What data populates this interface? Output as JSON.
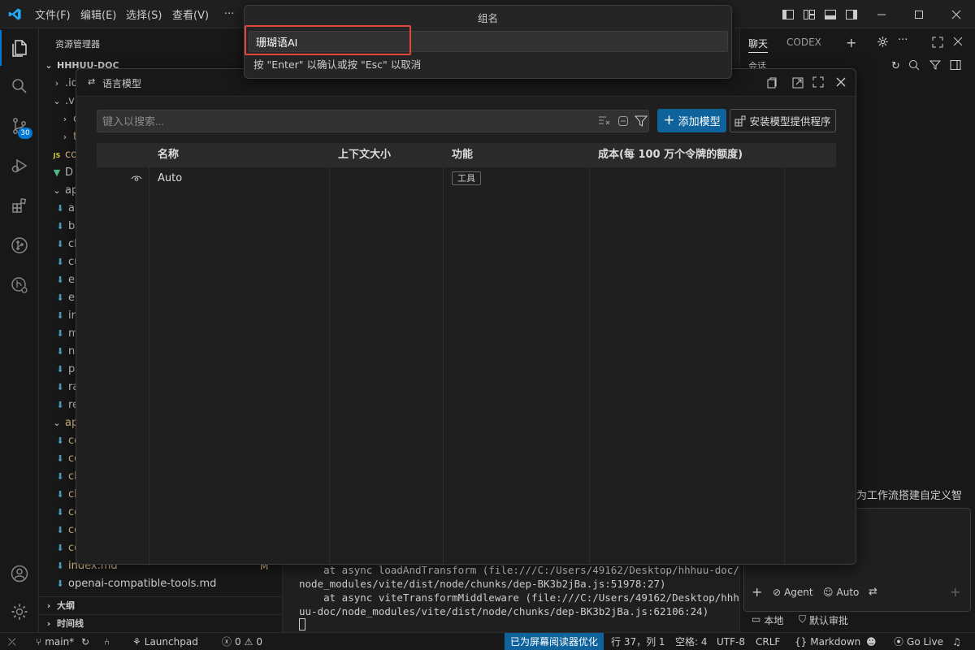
{
  "titlebar": {
    "menu": [
      "文件(F)",
      "编辑(E)",
      "选择(S)",
      "查看(V)",
      "···"
    ],
    "path_fragment": "vite/dist/node/chunks/dep-BK3b2jBa.js:51978"
  },
  "activitybar": {
    "source_control_badge": "30"
  },
  "explorer": {
    "title": "资源管理器",
    "root": "HHHUU-DOC",
    "rows": [
      ".ide",
      ".vit",
      "ca",
      "th",
      "co",
      "D",
      "api",
      "a",
      "b",
      "cl",
      "cu",
      "e",
      "e",
      "ir",
      "m",
      "n",
      "p",
      "ra",
      "re",
      "app",
      "co",
      "co",
      "cl",
      "cl",
      "co",
      "co",
      "co"
    ],
    "index_file": "index.md",
    "index_status": "M",
    "tools_file": "openai-compatible-tools.md",
    "outline": "大纲",
    "timeline": "时间线"
  },
  "terminal": {
    "lines": [
      "    at async loadAndTransform (file:///C:/Users/49162/Desktop/hhhuu-doc/",
      "node_modules/vite/dist/node/chunks/dep-BK3b2jBa.js:51978:27)",
      "    at async viteTransformMiddleware (file:///C:/Users/49162/Desktop/hhh",
      "uu-doc/node_modules/vite/dist/node/chunks/dep-BK3b2jBa.js:62106:24)"
    ]
  },
  "chat": {
    "tabs": [
      "聊天",
      "CODEX"
    ],
    "session_label": "会话",
    "hint": "为工作流搭建自定义智",
    "mode": "Agent",
    "model": "Auto",
    "local": "本地",
    "approval": "默认审批"
  },
  "lm_dialog": {
    "title": "语言模型",
    "search_placeholder": "键入以搜索...",
    "add_model": "添加模型",
    "install_provider": "安装模型提供程序",
    "columns": [
      "名称",
      "上下文大小",
      "功能",
      "成本(每 100 万个令牌的额度)"
    ],
    "rows": [
      {
        "name": "Auto",
        "context": "",
        "capability": "工具",
        "cost": ""
      }
    ]
  },
  "quick_input": {
    "title": "组名",
    "value": "珊瑚语AI",
    "hint": "按 \"Enter\" 以确认或按 \"Esc\" 以取消"
  },
  "statusbar": {
    "branch": "main*",
    "launchpad": "Launchpad",
    "errors": "0",
    "warnings": "0",
    "screen_reader": "已为屏幕阅读器优化",
    "position": "行 37，列 1",
    "spaces": "空格: 4",
    "encoding": "UTF-8",
    "eol": "CRLF",
    "language": "Markdown",
    "golive": "Go Live"
  },
  "colors": {
    "accent": "#0078d4",
    "primary_button": "#0e639c",
    "highlight": "#e0463b"
  }
}
